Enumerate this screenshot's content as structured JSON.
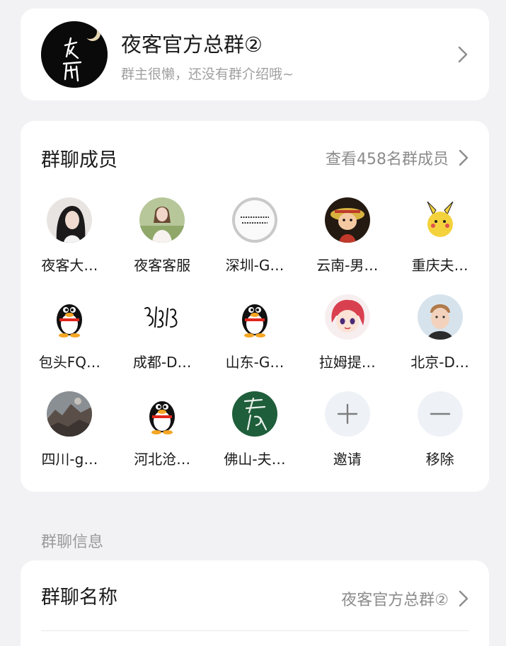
{
  "group": {
    "name": "夜客官方总群②",
    "description": "群主很懒，还没有群介绍哦~"
  },
  "members_section": {
    "title": "群聊成员",
    "view_all": "查看458名群成员",
    "members": [
      {
        "name": "夜客大…",
        "avatar": "photo-woman-icon"
      },
      {
        "name": "夜客客服",
        "avatar": "photo-girl-icon"
      },
      {
        "name": "深圳-G…",
        "avatar": "text-image-icon"
      },
      {
        "name": "云南-男…",
        "avatar": "luffy-cartoon-icon"
      },
      {
        "name": "重庆夫…",
        "avatar": "pikachu-cartoon-icon"
      },
      {
        "name": "包头FQ…",
        "avatar": "qq-penguin-icon"
      },
      {
        "name": "成都-D…",
        "avatar": "calligraphy-icon"
      },
      {
        "name": "山东-G…",
        "avatar": "qq-penguin-icon"
      },
      {
        "name": "拉姆提…",
        "avatar": "anime-girl-icon"
      },
      {
        "name": "北京-D…",
        "avatar": "photo-man-icon"
      },
      {
        "name": "四川-g…",
        "avatar": "photo-landscape-icon"
      },
      {
        "name": "河北沧…",
        "avatar": "qq-penguin-icon"
      },
      {
        "name": "佛山-夫…",
        "avatar": "green-seal-icon"
      }
    ],
    "invite_label": "邀请",
    "remove_label": "移除"
  },
  "info_section": {
    "label": "群聊信息",
    "name_label": "群聊名称",
    "name_value": "夜客官方总群②"
  },
  "colors": {
    "background": "#f2f2f4",
    "card": "#ffffff",
    "secondary_text": "#8c8c8c",
    "action_circle": "#eef1f6"
  }
}
